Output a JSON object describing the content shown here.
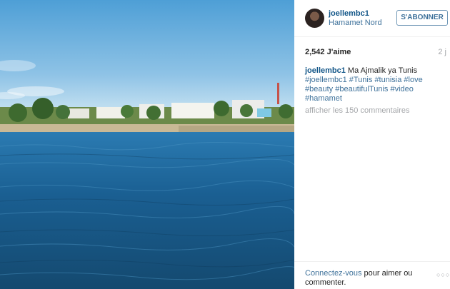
{
  "post": {
    "photo_alt": "Vue sur la mer à Hammamet"
  },
  "header": {
    "username": "joellembc1",
    "location": "Hamamet Nord",
    "follow_label": "S'ABONNER"
  },
  "stats": {
    "likes": "2,542 J'aime",
    "age": "2 j"
  },
  "caption": {
    "author": "joellembc1",
    "text": "Ma Ajmalik ya Tunis",
    "hashtags": [
      "#joellembc1",
      "#Tunis",
      "#tunisia",
      "#love",
      "#beauty",
      "#beautifulTunis",
      "#video",
      "#hamamet"
    ]
  },
  "comments": {
    "view_all": "afficher les 150 commentaires"
  },
  "footer": {
    "login_link": "Connectez-vous",
    "login_suffix": " pour aimer ou commenter.",
    "more_options": "○○○"
  },
  "icons": {
    "avatar": "profile-photo",
    "more": "ellipsis-icon"
  },
  "colors": {
    "link": "#125688",
    "accent": "#3f729b",
    "muted": "#a5a7aa"
  }
}
